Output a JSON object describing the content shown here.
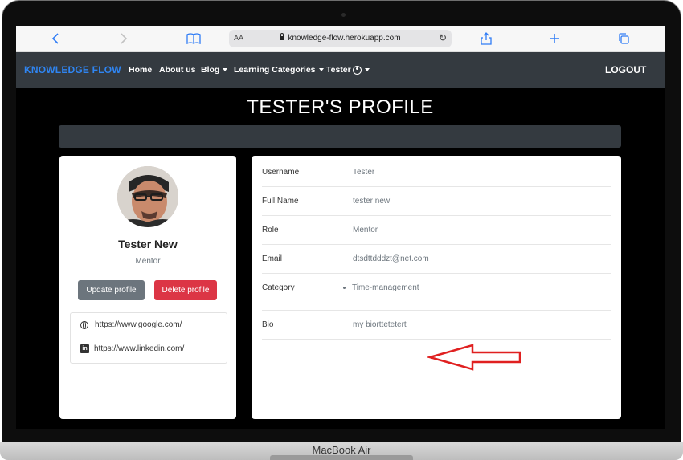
{
  "browser": {
    "text_size_label": "AA",
    "url": "knowledge-flow.herokuapp.com",
    "icons": [
      "back-icon",
      "forward-icon",
      "bookmarks-icon",
      "reload-icon",
      "share-icon",
      "new-tab-icon",
      "tabs-icon"
    ]
  },
  "navbar": {
    "brand": "KNOWLEDGE FLOW",
    "links": [
      "Home",
      "About us",
      "Blog",
      "Learning Categories",
      "Tester"
    ],
    "logout": "LOGOUT"
  },
  "page": {
    "title": "TESTER'S PROFILE"
  },
  "profile": {
    "name": "Tester New",
    "role": "Mentor",
    "update_button": "Update profile",
    "delete_button": "Delete profile",
    "links": [
      "https://www.google.com/",
      "https://www.linkedin.com/"
    ]
  },
  "details": {
    "rows": [
      {
        "label": "Username",
        "value": "Tester"
      },
      {
        "label": "Full Name",
        "value": "tester new"
      },
      {
        "label": "Role",
        "value": "Mentor"
      },
      {
        "label": "Email",
        "value": "dtsdttdddzt@net.com"
      },
      {
        "label": "Category",
        "value": "Time-management"
      },
      {
        "label": "Bio",
        "value": "my biorttetetert"
      }
    ]
  },
  "device": {
    "label": "MacBook Air"
  },
  "colors": {
    "brand_blue": "#2f85f2",
    "navbar_bg": "#343a40",
    "danger": "#dc3545",
    "secondary": "#6c757d",
    "annotation_arrow": "#e02020"
  }
}
